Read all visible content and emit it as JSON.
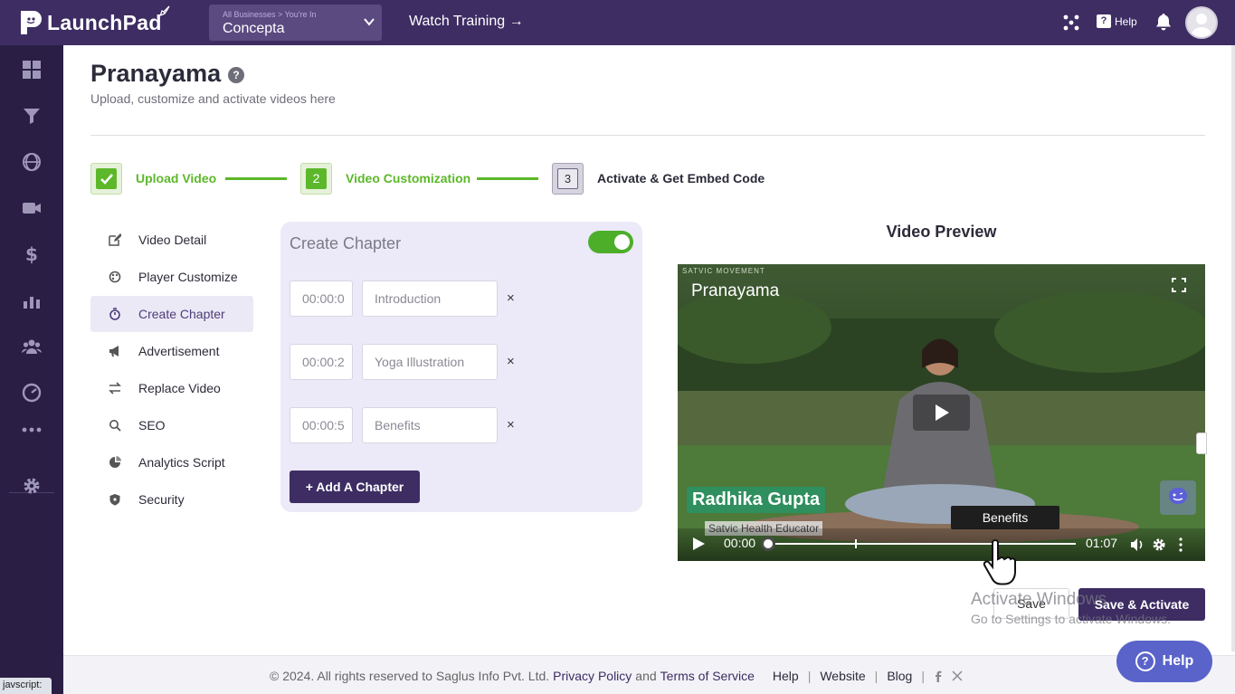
{
  "app": {
    "name": "LaunchPad"
  },
  "topbar": {
    "business_crumb": "All Businesses > You're In",
    "business_name": "Concepta",
    "watch_training": "Watch Training →",
    "help_label": "Help",
    "icons": [
      "apps-grid-icon",
      "help-icon",
      "bell-icon",
      "avatar"
    ]
  },
  "sidebar": {
    "icons": [
      "dashboard-icon",
      "funnel-icon",
      "globe-icon",
      "video-icon",
      "dollar-icon",
      "analytics-icon",
      "users-icon",
      "gauge-icon",
      "more-icon",
      "settings-icon"
    ],
    "status_text": "javscript:"
  },
  "page": {
    "title": "Pranayama",
    "subtitle": "Upload, customize and activate videos here"
  },
  "steps": [
    {
      "number": "",
      "label": "Upload Video",
      "state": "done"
    },
    {
      "number": "2",
      "label": "Video Customization",
      "state": "current"
    },
    {
      "number": "3",
      "label": "Activate & Get Embed Code",
      "state": "pending"
    }
  ],
  "menu": [
    {
      "label": "Video Detail",
      "icon": "edit-icon"
    },
    {
      "label": "Player Customize",
      "icon": "palette-icon"
    },
    {
      "label": "Create Chapter",
      "icon": "timer-icon",
      "active": true
    },
    {
      "label": "Advertisement",
      "icon": "megaphone-icon"
    },
    {
      "label": "Replace Video",
      "icon": "swap-icon"
    },
    {
      "label": "SEO",
      "icon": "search-icon"
    },
    {
      "label": "Analytics Script",
      "icon": "pie-chart-icon"
    },
    {
      "label": "Security",
      "icon": "shield-icon"
    }
  ],
  "chapters": {
    "title": "Create Chapter",
    "enabled": true,
    "items": [
      {
        "time": "00:00:0",
        "name": "Introduction"
      },
      {
        "time": "00:00:2",
        "name": "Yoga Illustration"
      },
      {
        "time": "00:00:5",
        "name": "Benefits"
      }
    ],
    "add_label": "+ Add A Chapter"
  },
  "preview": {
    "heading": "Video Preview",
    "brand": "SATVIC MOVEMENT",
    "video_title": "Pranayama",
    "lower_third_name": "Radhika Gupta",
    "lower_third_role": "Satvic Health Educator",
    "tooltip": "Benefits",
    "current_time": "00:00",
    "duration": "01:07"
  },
  "actions": {
    "save": "Save",
    "save_activate": "Save & Activate"
  },
  "watermark": {
    "line1": "Activate Windows",
    "line2": "Go to Settings to activate Windows."
  },
  "footer": {
    "copyright": "©  2024. All rights reserved to Saglus Info Pvt. Ltd.",
    "privacy": "Privacy Policy",
    "and": "and",
    "terms": "Terms of Service",
    "help": "Help",
    "website": "Website",
    "blog": "Blog",
    "sep": "|"
  },
  "help_fab": "Help",
  "colors": {
    "primary": "#3d2d63",
    "sidebar": "#2a1e45",
    "success": "#5cb82a",
    "card": "#ece9f8"
  }
}
